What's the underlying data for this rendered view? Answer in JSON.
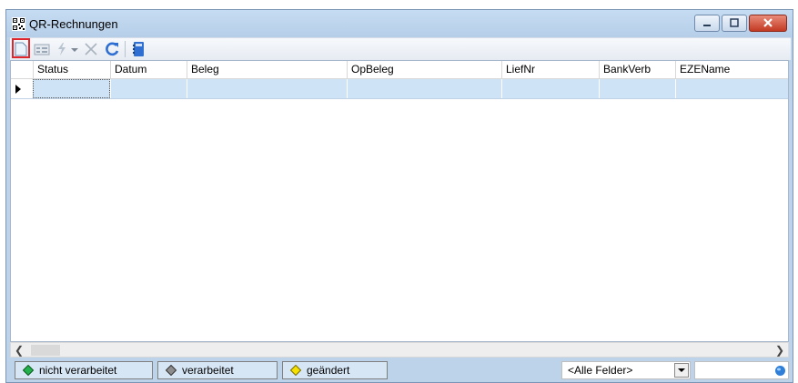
{
  "window": {
    "title": "QR-Rechnungen"
  },
  "toolbar": {
    "buttons": [
      {
        "icon": "new-document-icon"
      },
      {
        "icon": "form-view-icon"
      },
      {
        "icon": "filter-lightning-icon"
      },
      {
        "icon": "dropdown-arrow-icon"
      },
      {
        "icon": "delete-icon"
      },
      {
        "icon": "refresh-icon"
      },
      {
        "icon": "notebook-icon"
      }
    ]
  },
  "grid": {
    "columns": [
      "Status",
      "Datum",
      "Beleg",
      "OpBeleg",
      "LiefNr",
      "BankVerb",
      "EZEName"
    ]
  },
  "status": {
    "filters": {
      "not_processed": "nicht verarbeitet",
      "processed": "verarbeitet",
      "changed": "geändert"
    },
    "field_select": "<Alle Felder>"
  },
  "colors": {
    "accent_selection": "#cfe3f7",
    "green": "#22b14c",
    "yellow": "#f5e000",
    "highlight_border": "#e0262c"
  }
}
